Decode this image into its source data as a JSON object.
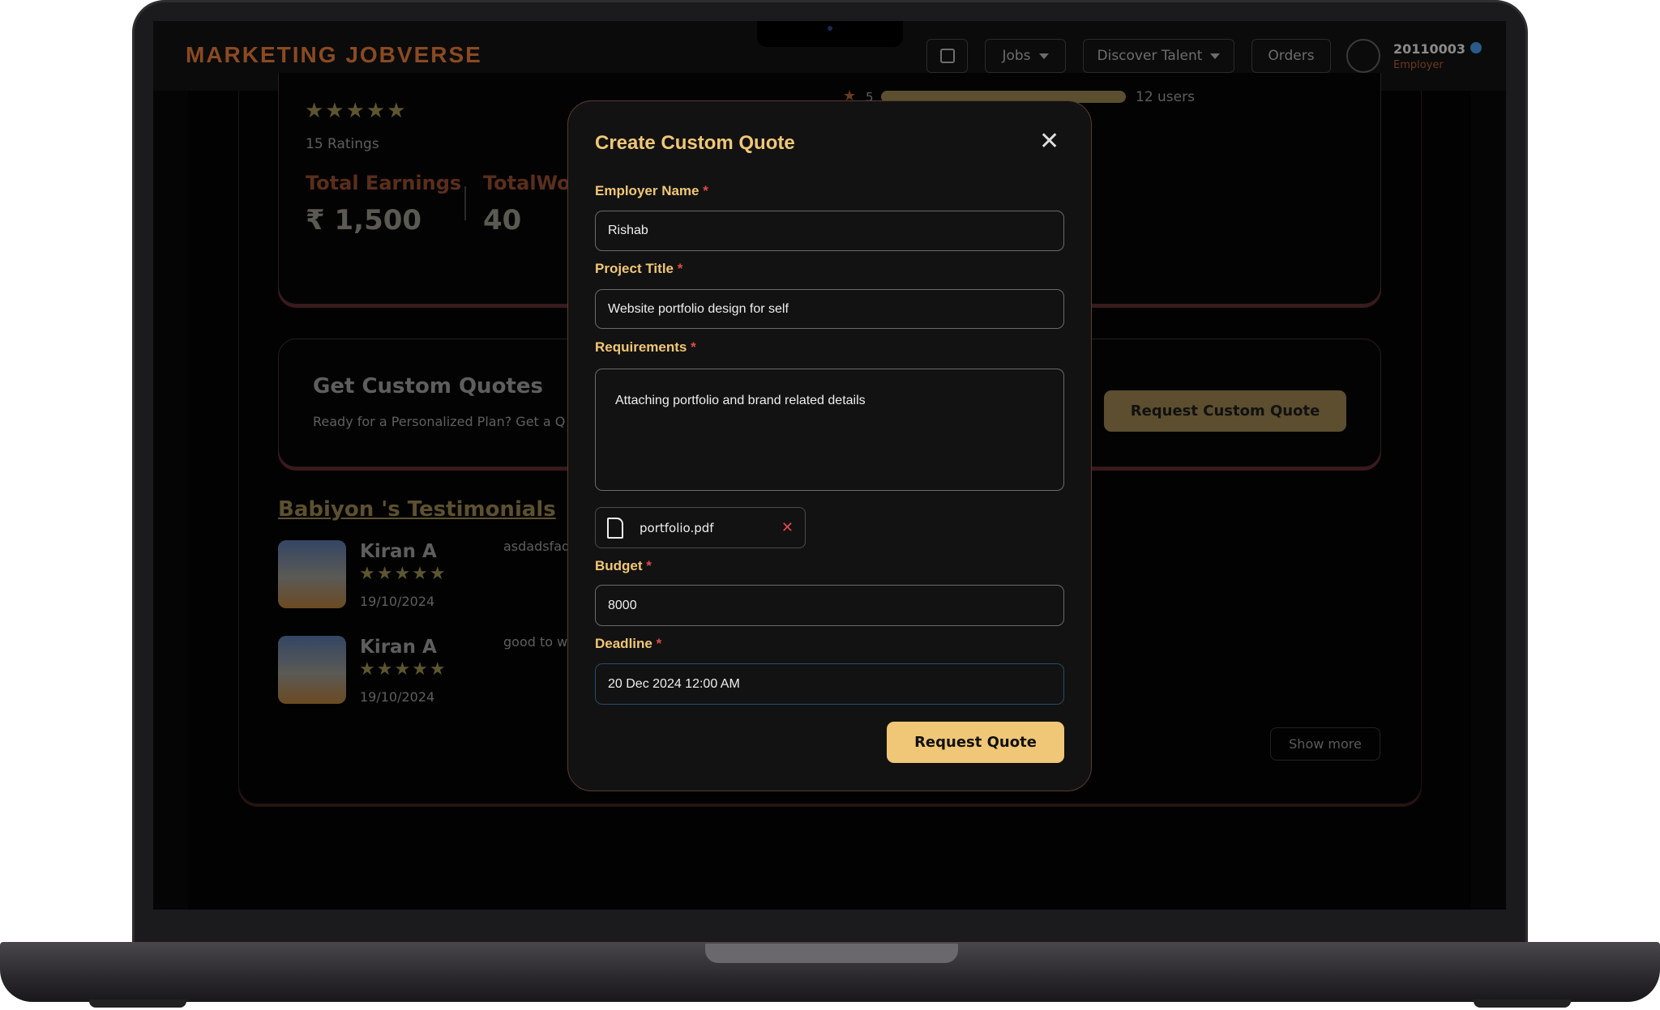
{
  "brand": {
    "logo": "MARKETING JOBVERSE",
    "accent": "#f0c776"
  },
  "nav": {
    "chat_icon": "message-icon",
    "jobs": "Jobs",
    "discover": "Discover Talent",
    "orders": "Orders",
    "user_id": "20110003",
    "user_role": "Employer"
  },
  "profile": {
    "rating_stars": 5,
    "ratings": "15 Ratings",
    "earnings_label": "Total Earnings",
    "earnings_value": "₹ 1,500",
    "work_label": "TotalWor",
    "work_value": "40",
    "bar_star": "5",
    "bar_users": "12 users"
  },
  "quotes": {
    "title": "Get Custom Quotes",
    "subtitle": "Ready for a Personalized Plan? Get a Q",
    "button": "Request Custom Quote"
  },
  "testimonials": {
    "heading": "Babiyon 's Testimonials",
    "items": [
      {
        "name": "Kiran A",
        "date": "19/10/2024",
        "text": "asdadsfad",
        "stars": 5
      },
      {
        "name": "Kiran A",
        "date": "19/10/2024",
        "text": "good to w",
        "stars": 5
      }
    ],
    "show_more": "Show more"
  },
  "modal": {
    "title": "Create Custom Quote",
    "employer_label": "Employer Name",
    "employer_value": "Rishab",
    "project_label": "Project Title",
    "project_value": "Website portfolio design for self",
    "req_label": "Requirements",
    "req_value": "Attaching portfolio and brand related details",
    "file_name": "portfolio.pdf",
    "budget_label": "Budget",
    "budget_value": "8000",
    "deadline_label": "Deadline",
    "deadline_value": "20 Dec 2024 12:00 AM",
    "submit": "Request Quote",
    "required_mark": "*"
  }
}
